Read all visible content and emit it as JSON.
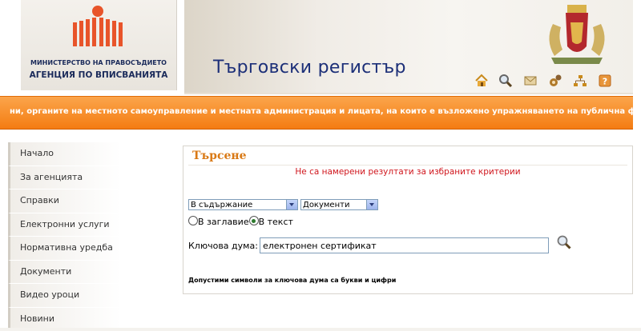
{
  "header": {
    "logo_line1": "МИНИСТЕРСТВО НА ПРАВОСЪДИЕТО",
    "logo_line2": "АГЕНЦИЯ ПО ВПИСВАНИЯТА",
    "title": "Търговски регистър",
    "toolbar": [
      "home-icon",
      "search-icon",
      "mail-icon",
      "settings-icon",
      "sitemap-icon",
      "help-icon"
    ]
  },
  "ticker": {
    "text": "ни, органите на местното самоуправление и местната администрация и лицата, на които е възложено упражняването на публична фук"
  },
  "nav": {
    "items": [
      {
        "label": "Начало"
      },
      {
        "label": "За агенцията"
      },
      {
        "label": "Справки"
      },
      {
        "label": "Електронни услуги"
      },
      {
        "label": "Нормативна уредба"
      },
      {
        "label": "Документи"
      },
      {
        "label": "Видео уроци"
      },
      {
        "label": "Новини"
      }
    ]
  },
  "search": {
    "title": "Търсене",
    "message": "Не са намерени резултати за избраните критерии",
    "scope_select": "В съдържание",
    "type_select": "Документи",
    "radio_title": "В заглавие",
    "radio_text": "В текст",
    "keyword_label": "Ключова дума:",
    "keyword_star": "*",
    "keyword_value": "електронен сертификат",
    "hint": "Допустими символи за ключова дума са букви и цифри"
  },
  "colors": {
    "accent_orange": "#f47c12",
    "title_blue": "#1c2f78",
    "error_red": "#d0161d",
    "heading_orange": "#d97915"
  }
}
